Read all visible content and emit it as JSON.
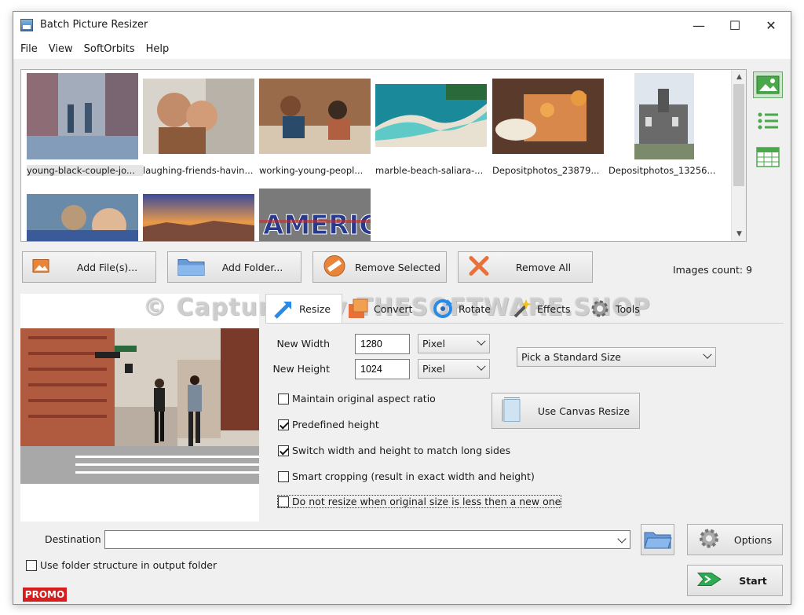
{
  "window": {
    "title": "Batch Picture Resizer",
    "controls": {
      "minimize": "—",
      "maximize": "☐",
      "close": "✕"
    }
  },
  "menu": [
    "File",
    "View",
    "SoftOrbits",
    "Help"
  ],
  "thumbnails": [
    {
      "name": "young-black-couple-jo...",
      "selected": true
    },
    {
      "name": "laughing-friends-havin..."
    },
    {
      "name": "working-young-peopl..."
    },
    {
      "name": "marble-beach-saliara-..."
    },
    {
      "name": "Depositphotos_23879..."
    },
    {
      "name": "Depositphotos_13256..."
    },
    {
      "name": ""
    },
    {
      "name": ""
    },
    {
      "name": ""
    }
  ],
  "side_views": [
    "thumbnail-view-icon",
    "list-view-icon",
    "table-view-icon"
  ],
  "toolbar": {
    "add_files": "Add File(s)...",
    "add_folder": "Add Folder...",
    "remove_selected": "Remove Selected",
    "remove_all": "Remove All",
    "images_count": "Images count: 9"
  },
  "watermark": "© Captured by THESOFTWARE.SHOP",
  "tabs": [
    {
      "label": "Resize",
      "active": true
    },
    {
      "label": "Convert"
    },
    {
      "label": "Rotate"
    },
    {
      "label": "Effects"
    },
    {
      "label": "Tools"
    }
  ],
  "resize": {
    "new_width_label": "New Width",
    "new_width": "1280",
    "width_unit": "Pixel",
    "new_height_label": "New Height",
    "new_height": "1024",
    "height_unit": "Pixel",
    "standard_size": "Pick a Standard Size",
    "canvas_button": "Use Canvas Resize",
    "options": [
      {
        "label": "Maintain original aspect ratio",
        "checked": false
      },
      {
        "label": "Predefined height",
        "checked": true
      },
      {
        "label": "Switch width and height to match long sides",
        "checked": true
      },
      {
        "label": "Smart cropping (result in exact width and height)",
        "checked": false
      },
      {
        "label": "Do not resize when original size is less then a new one",
        "checked": false
      }
    ]
  },
  "destination": {
    "label": "Destination",
    "value": "",
    "folder_structure_label": "Use folder structure in output folder",
    "folder_structure_checked": false
  },
  "footer": {
    "options": "Options",
    "start": "Start",
    "promo": "PROMO"
  },
  "colors": {
    "accent_blue": "#3a78b8",
    "promo_red": "#d61e1e",
    "start_green": "#2eaa55"
  }
}
